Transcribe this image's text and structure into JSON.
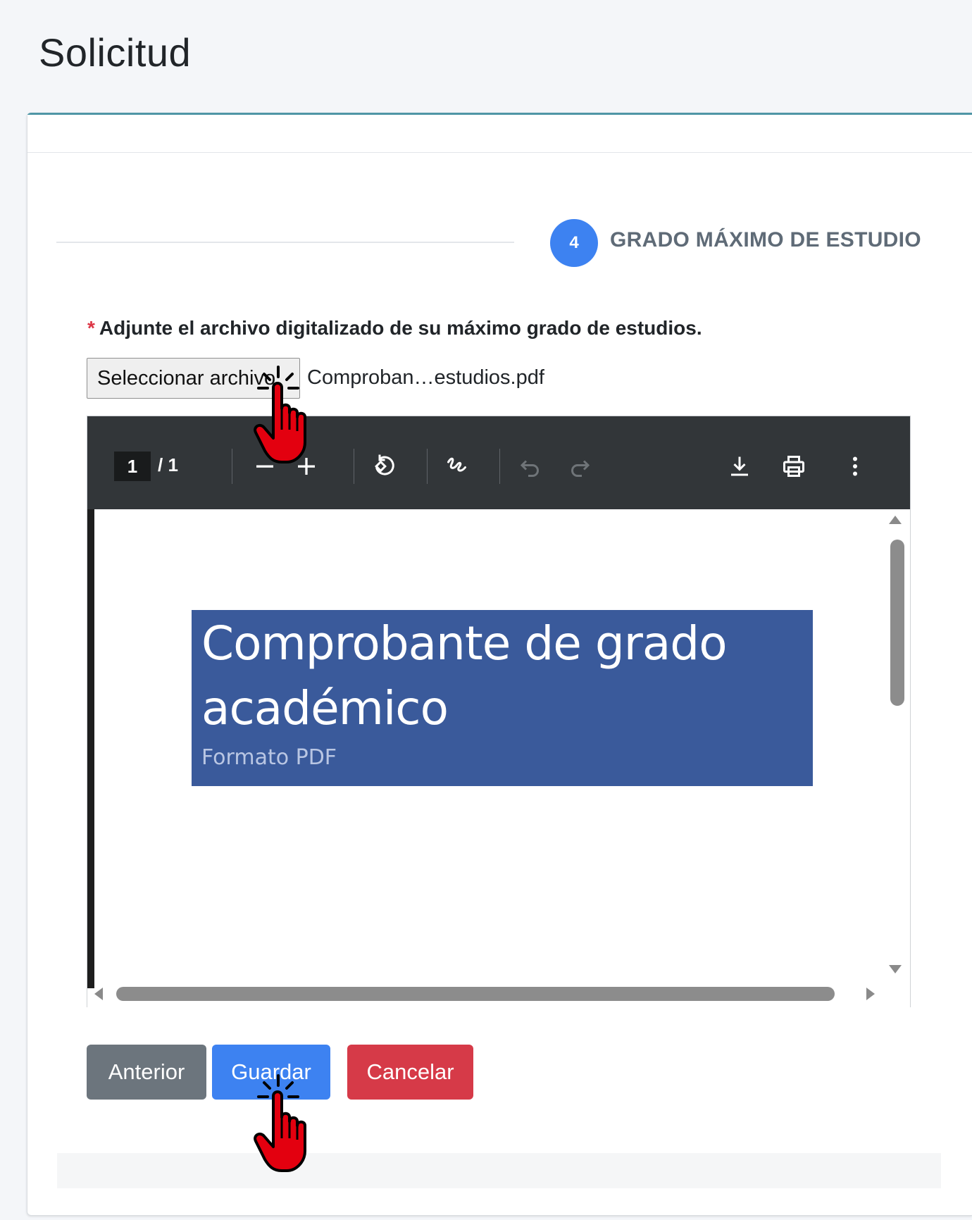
{
  "page": {
    "title": "Solicitud"
  },
  "stepper": {
    "number": "4",
    "label": "GRADO MÁXIMO DE ESTUDIO"
  },
  "form": {
    "required_mark": "*",
    "label": "Adjunte el archivo digitalizado de su máximo grado de estudios.",
    "file_button": "Seleccionar archivo",
    "file_name": "Comproban…estudios.pdf"
  },
  "pdf_viewer": {
    "page_current": "1",
    "page_total": "/ 1",
    "toolbar_icons": [
      "zoom-out-icon",
      "zoom-in-icon",
      "rotate-icon",
      "annotate-icon",
      "undo-icon",
      "redo-icon",
      "download-icon",
      "print-icon",
      "more-options-icon"
    ],
    "document": {
      "title": "Comprobante de grado académico",
      "subtitle": "Formato PDF"
    }
  },
  "actions": {
    "previous": "Anterior",
    "save": "Guardar",
    "cancel": "Cancelar"
  },
  "colors": {
    "primary": "#3d82f1",
    "secondary": "#6c757d",
    "danger": "#d63a48",
    "card_accent": "#4f96a6",
    "banner": "#3a5a9b",
    "cursor": "#e3000f"
  }
}
